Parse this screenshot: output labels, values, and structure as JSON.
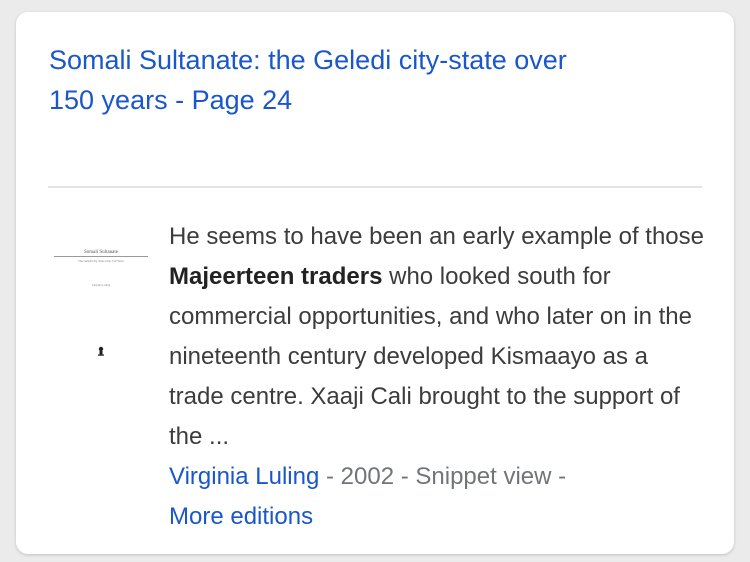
{
  "result": {
    "title_line1": "Somali Sultanate: the Geledi city-state over",
    "title_line2": "150 years - Page 24",
    "snippet": {
      "before": "He seems to have been an early example of those ",
      "highlight": "Majeerteen traders",
      "after": " who looked south for commercial opportunities, and who later on in the nineteenth century developed Kismaayo as a trade centre. Xaaji Cali brought to the support of the ..."
    },
    "author": "Virginia Luling",
    "sep1": " - ",
    "year": "2002",
    "sep2": " - ",
    "view": "Snippet view",
    "sep3": " - ",
    "more_editions": "More editions"
  },
  "thumbnail": {
    "icon": "book-cover-thumbnail",
    "cover_title": "Somali Sultanate",
    "cover_subtitle": "The Geledi City-State Over 150 Years",
    "cover_author": "Virginia Luling"
  },
  "colors": {
    "link": "#1a57c9",
    "text": "#3c3c3c",
    "meta": "#70757a",
    "card": "#ffffff",
    "background": "#ebebeb"
  }
}
